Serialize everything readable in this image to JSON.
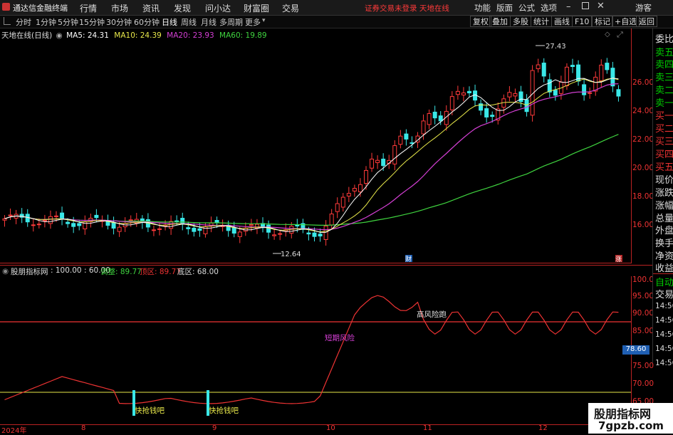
{
  "topbar": {
    "app_title": "通达信金融终端",
    "menu": [
      "行情",
      "市场",
      "资讯",
      "发现",
      "问小达",
      "财富圈",
      "交易"
    ],
    "warning": "证券交易未登录  天地在线",
    "right_items": [
      "功能",
      "版面",
      "公式",
      "选项"
    ],
    "guest": "游客"
  },
  "timeframes": [
    "分时",
    "1分钟",
    "5分钟",
    "15分钟",
    "30分钟",
    "60分钟",
    "日线",
    "周线",
    "月线",
    "多周期",
    "更多"
  ],
  "active_timeframe": "日线",
  "tools": [
    "复权",
    "叠加",
    "多股",
    "统计",
    "画线",
    "F10",
    "标记",
    "+自选",
    "返回"
  ],
  "ma_legend": {
    "name": "天地在线(日线)",
    "ma5": "MA5: 24.31",
    "ma10": "MA10: 24.39",
    "ma20": "MA20: 23.93",
    "ma60": "MA60: 19.89"
  },
  "colors": {
    "ma5": "#ffffff",
    "ma10": "#e8e84a",
    "ma20": "#d43fd4",
    "ma60": "#3fd43f",
    "up": "#ff3a3a",
    "down": "#3ae8e8"
  },
  "price_axis": [
    "26.00",
    "24.00",
    "22.00",
    "20.00",
    "18.00",
    "16.00",
    "14.00"
  ],
  "annotations": {
    "high": "27.43",
    "low": "12.64",
    "fin": "财",
    "zhang": "涨"
  },
  "indicator": {
    "name": "股朋指标网",
    "params": ": 100.00 : 60.00",
    "tiaozheng": "调整: 89.77",
    "dingqu": "顶区: 89.77",
    "diqu": "底区: 68.00",
    "axis": [
      "100.00",
      "95.00",
      "90.00",
      "85.00",
      "80.00",
      "75.00",
      "70.00",
      "65.00"
    ],
    "label_high": "高风险跑",
    "label_short": "短期风险",
    "label_buy1": "快抢钱吧",
    "label_buy2": "快抢钱吧",
    "value_tag": "78.60"
  },
  "xaxis": [
    "2024年",
    "8",
    "9",
    "10",
    "11",
    "12"
  ],
  "sidepanel": {
    "items": [
      "委比",
      "卖五",
      "卖四",
      "卖三",
      "卖二",
      "卖一",
      "买一",
      "买二",
      "买三",
      "买四",
      "买五",
      "现价",
      "涨跌",
      "涨幅",
      "总量",
      "外盘",
      "换手",
      "净资",
      "收益",
      "自动",
      "交易"
    ],
    "times": [
      "14:56",
      "14:56",
      "14:56",
      "14:56",
      "14:56",
      "14:56",
      "14:56",
      "14:56"
    ]
  },
  "watermark": {
    "cn": "股朋指标网",
    "url": "7gpzb.com"
  }
}
